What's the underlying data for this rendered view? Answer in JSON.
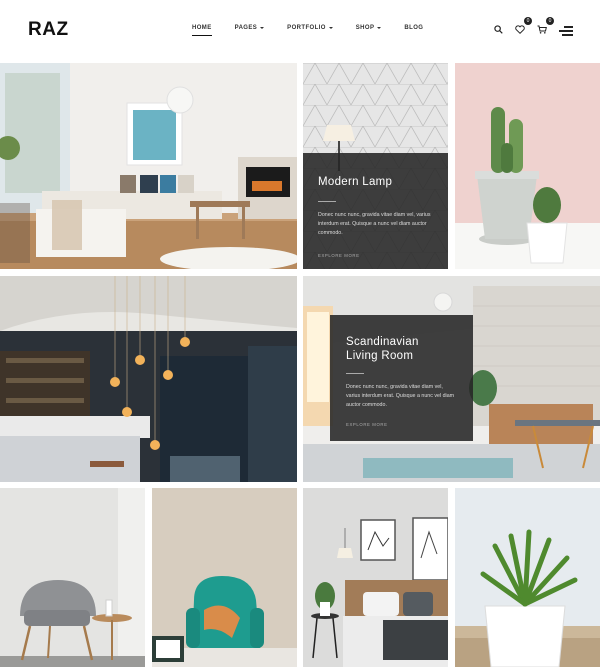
{
  "brand": {
    "logo": "RAZ"
  },
  "nav": {
    "items": [
      {
        "label": "HOME",
        "active": true,
        "dropdown": false
      },
      {
        "label": "PAGES",
        "active": false,
        "dropdown": true
      },
      {
        "label": "PORTFOLIO",
        "active": false,
        "dropdown": true
      },
      {
        "label": "SHOP",
        "active": false,
        "dropdown": true
      },
      {
        "label": "BLOG",
        "active": false,
        "dropdown": false
      }
    ]
  },
  "tools": {
    "search_icon": "search-icon",
    "wishlist_count": "0",
    "cart_count": "0",
    "menu_icon": "hamburger-menu-icon"
  },
  "portfolio": {
    "modern_lamp": {
      "title": "Modern Lamp",
      "text": "Donec nunc nunc, gravida vitae diam vel, varius interdum erat. Quisque a nunc vel diam auctor commodo.",
      "link": "EXPLORE MORE"
    },
    "scandinavian": {
      "title_line1": "Scandinavian",
      "title_line2": "Living Room",
      "text": "Donec nunc nunc, gravida vitae diam vel, varius interdum erat. Quisque a nunc vel diam auctor commodo.",
      "link": "EXPLORE MORE"
    }
  },
  "colors": {
    "overlay": "#262626",
    "accent_teal": "#1e9c8f",
    "pink_wall": "#efd2cf"
  }
}
